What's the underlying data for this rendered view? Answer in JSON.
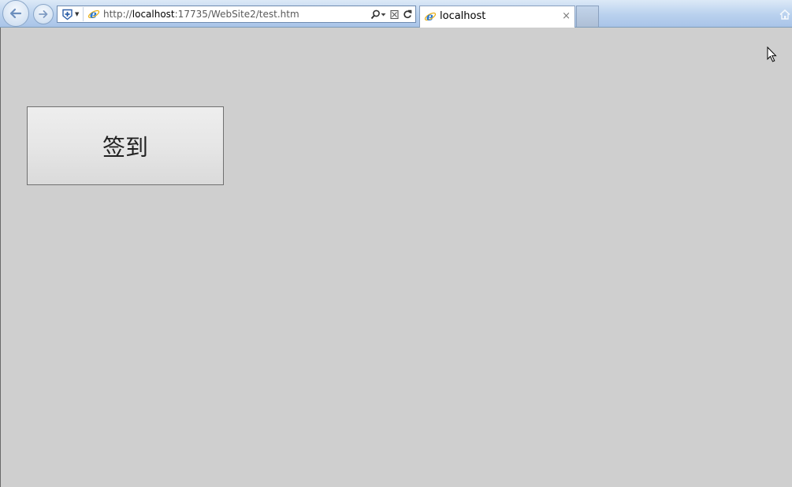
{
  "browser": {
    "address_bar": {
      "url_prefix": "http://",
      "url_host": "localhost",
      "url_rest": ":17735/WebSite2/test.htm"
    },
    "tab": {
      "title": "localhost",
      "close_glyph": "×"
    },
    "icons": {
      "back": "back-arrow-icon",
      "forward": "forward-arrow-icon",
      "compat": "compatibility-shield-icon",
      "page": "ie-logo-icon",
      "search": "search-icon",
      "dropdown": "chevron-down-icon",
      "compat_view": "compat-view-icon",
      "refresh": "refresh-icon",
      "home": "home-icon"
    },
    "colors": {
      "chrome_top": "#dce9f7",
      "chrome_bottom": "#a9c4e8",
      "ie_blue": "#2a78d0",
      "ie_gold": "#e9b21e"
    }
  },
  "page": {
    "background": "#cfcfcf",
    "signin_button": {
      "label": "签到"
    }
  }
}
